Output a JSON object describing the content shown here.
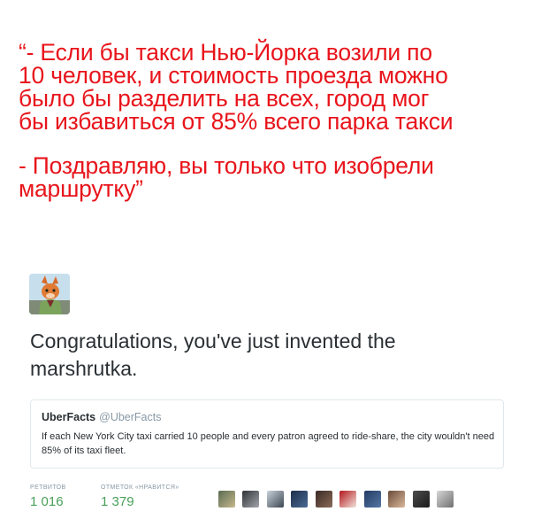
{
  "caption": {
    "lines": [
      "“- Если бы такси Нью-Йорка возили по",
      "10 человек, и стоимость проезда можно",
      "было бы разделить на всех, город мог",
      "бы избавиться от 85% всего парка такси",
      "- Поздравляю, вы только что изобрели",
      "маршрутку”"
    ]
  },
  "tweet": {
    "text": "Congratulations, you've just invented the marshrutka.",
    "avatar_icon": "fox-avatar",
    "quote": {
      "name": "UberFacts",
      "handle": "@UberFacts",
      "body": "If each New York City taxi carried 10 people and every patron agreed to ride-share, the city wouldn't need 85% of its taxi fleet."
    },
    "stats": {
      "retweets_label": "РЕТВИТОВ",
      "retweets_value": "1 016",
      "likes_label": "ОТМЕТОК «НРАВИТСЯ»",
      "likes_value": "1 379"
    },
    "likers_count_shown": 10
  },
  "colors": {
    "caption": "#e8141b",
    "stat_value": "#49a05a",
    "muted": "#8899a6"
  }
}
